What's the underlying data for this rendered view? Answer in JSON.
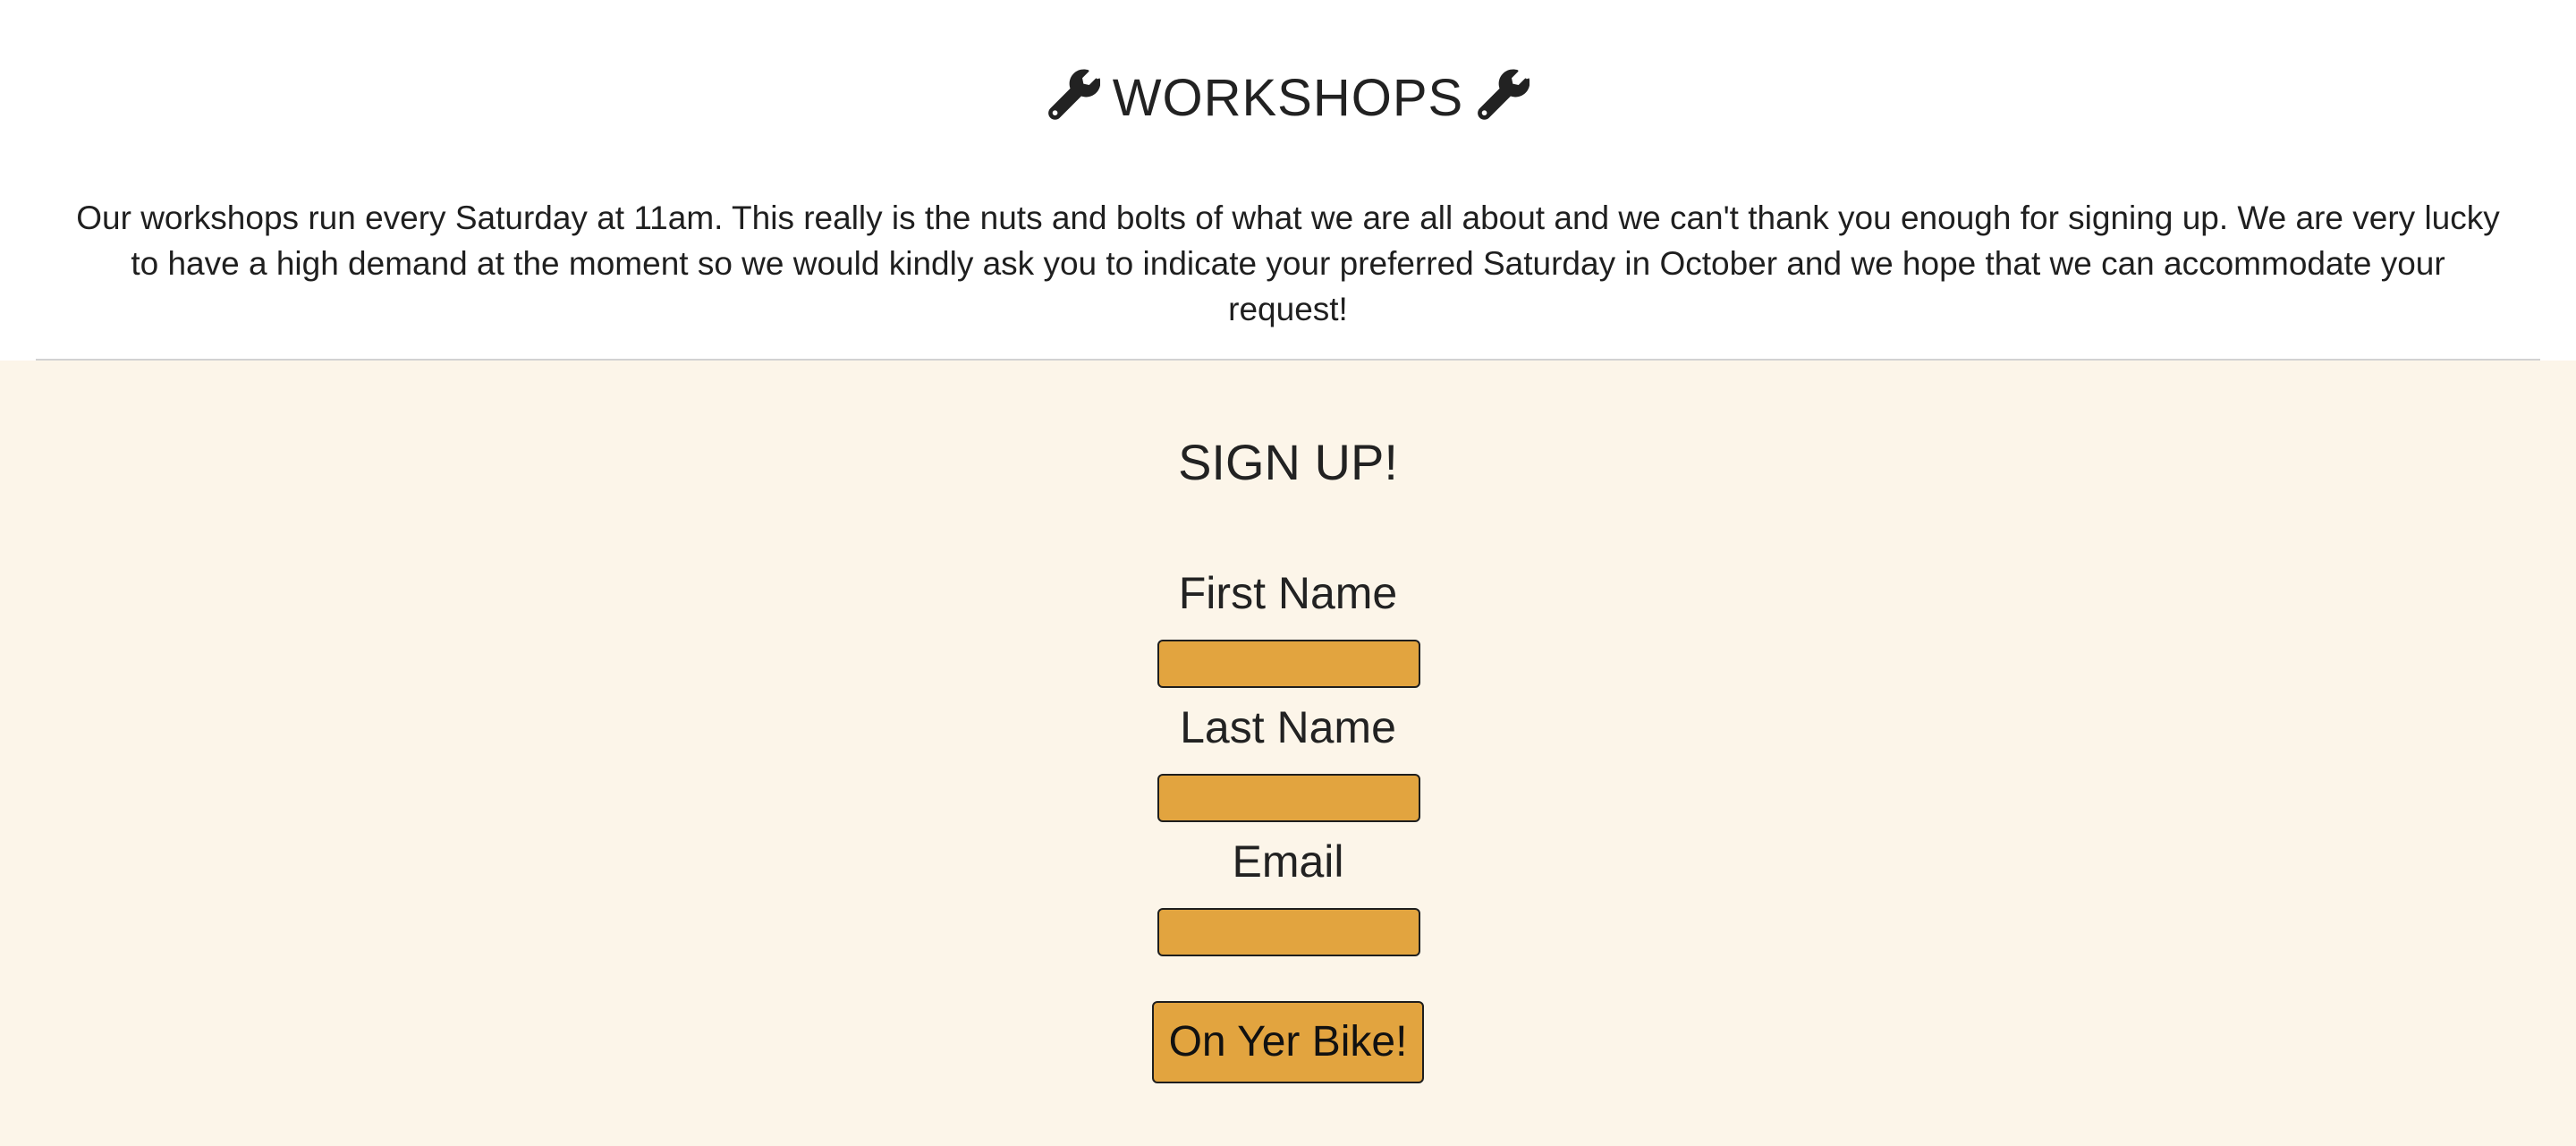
{
  "intro": {
    "title": "WORKSHOPS",
    "title_icon": "wrench-icon",
    "description": "Our workshops run every Saturday at 11am. This really is the nuts and bolts of what we are all about and we can't thank you enough for signing up. We are very lucky to have a high demand at the moment so we would kindly ask you to indicate your preferred Saturday in October and we hope that we can accommodate your request!"
  },
  "signup": {
    "title": "SIGN UP!",
    "fields": [
      {
        "label": "First Name",
        "value": ""
      },
      {
        "label": "Last Name",
        "value": ""
      },
      {
        "label": "Email",
        "value": ""
      }
    ],
    "submit_label": "On Yer Bike!"
  },
  "colors": {
    "accent": "#e2a43f",
    "signup_background": "#fcf5e9",
    "text": "#222222",
    "divider": "#d2d2d2"
  }
}
